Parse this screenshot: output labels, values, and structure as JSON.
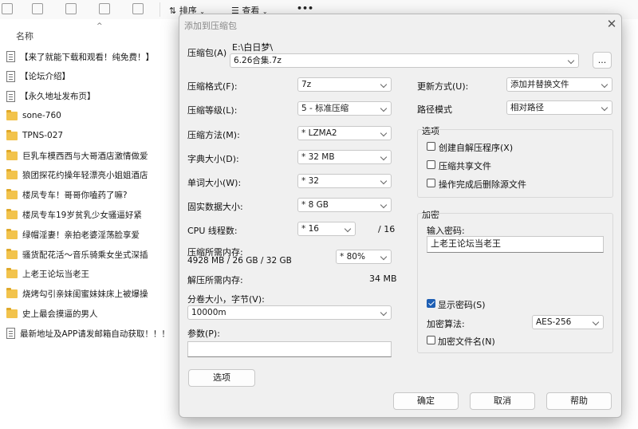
{
  "toolbar": {
    "sort_label": "排序",
    "view_label": "查看",
    "more_label": "•••"
  },
  "explorer": {
    "column_name": "名称",
    "files": [
      {
        "type": "doc",
        "name": "【来了就能下载和观看！纯免费！】"
      },
      {
        "type": "doc",
        "name": "【论坛介绍】"
      },
      {
        "type": "doc",
        "name": "【永久地址发布页】"
      },
      {
        "type": "folder",
        "name": "sone-760"
      },
      {
        "type": "folder",
        "name": "TPNS-027"
      },
      {
        "type": "folder",
        "name": "巨乳车模西西与大哥酒店激情做爱"
      },
      {
        "type": "folder",
        "name": "狼团探花约操年轻漂亮小姐姐酒店"
      },
      {
        "type": "folder",
        "name": "楼凤专车！哥哥你嗑药了嘛?"
      },
      {
        "type": "folder",
        "name": "楼凤专车19岁贫乳少女骚逼好紧"
      },
      {
        "type": "folder",
        "name": "绿帽淫妻！亲拍老婆淫荡脸享爱"
      },
      {
        "type": "folder",
        "name": "骚货配花活～音乐骑乘女坐式深插"
      },
      {
        "type": "folder",
        "name": "上老王论坛当老王"
      },
      {
        "type": "folder",
        "name": "烧烤勾引亲妹闺蜜妹妹床上被爆操"
      },
      {
        "type": "folder",
        "name": "史上最会摸逼的男人"
      },
      {
        "type": "doc",
        "name": "最新地址及APP请发邮箱自动获取！！！"
      }
    ]
  },
  "dialog": {
    "title": "添加到压缩包",
    "close": "✕",
    "archive_label": "压缩包(A)",
    "archive_path": "E:\\白日梦\\",
    "archive_name": "6.26合集.7z",
    "browse_label": "...",
    "format_label": "压缩格式(F):",
    "format_value": "7z",
    "level_label": "压缩等级(L):",
    "level_value": "5 - 标准压缩",
    "method_label": "压缩方法(M):",
    "method_value": "*  LZMA2",
    "dict_label": "字典大小(D):",
    "dict_value": "*  32 MB",
    "word_label": "单词大小(W):",
    "word_value": "*  32",
    "solid_label": "固实数据大小:",
    "solid_value": "*  8 GB",
    "cpu_label": "CPU 线程数:",
    "cpu_value": "*  16",
    "cpu_total": "/ 16",
    "mem_comp_label": "压缩所需内存:",
    "mem_comp_detail": "4928 MB / 26 GB / 32 GB",
    "mem_comp_value": "*  80%",
    "mem_decomp_label": "解压所需内存:",
    "mem_decomp_value": "34 MB",
    "split_label": "分卷大小，字节(V):",
    "split_value": "10000m",
    "params_label": "参数(P):",
    "params_value": "",
    "options_button": "选项",
    "update_label": "更新方式(U):",
    "update_value": "添加并替换文件",
    "path_label": "路径模式",
    "path_value": "相对路径",
    "options_group": "选项",
    "opt_sfx": "创建自解压程序(X)",
    "opt_shared": "压缩共享文件",
    "opt_delete": "操作完成后删除源文件",
    "encrypt_group": "加密",
    "password_label": "输入密码:",
    "password_value": "上老王论坛当老王",
    "show_password": "显示密码(S)",
    "enc_method_label": "加密算法:",
    "enc_method_value": "AES-256",
    "encrypt_names": "加密文件名(N)",
    "ok": "确定",
    "cancel": "取消",
    "help": "帮助"
  }
}
